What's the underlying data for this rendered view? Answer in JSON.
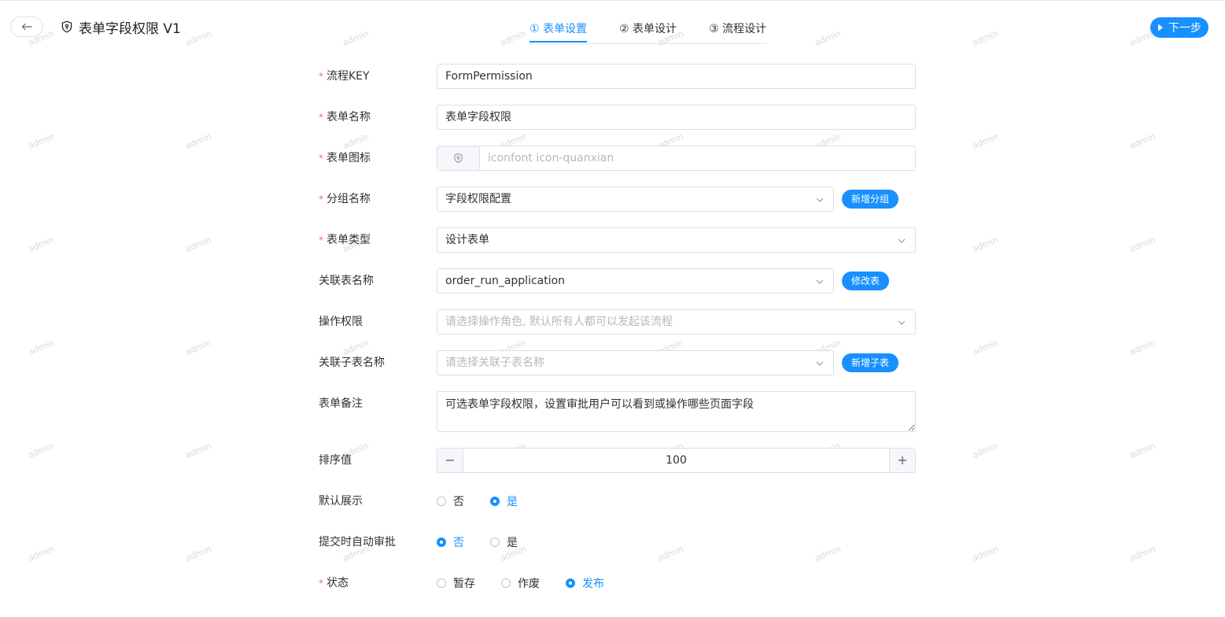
{
  "header": {
    "title": "表单字段权限 V1",
    "next_label": "下一步"
  },
  "steps": [
    {
      "label": "① 表单设置",
      "active": true
    },
    {
      "label": "② 表单设计",
      "active": false
    },
    {
      "label": "③ 流程设计",
      "active": false
    }
  ],
  "watermark": "admin",
  "form": {
    "process_key": {
      "label": "流程KEY",
      "required": true,
      "value": "FormPermission"
    },
    "form_name": {
      "label": "表单名称",
      "required": true,
      "value": "表单字段权限"
    },
    "form_icon": {
      "label": "表单图标",
      "required": true,
      "placeholder": "iconfont icon-quanxian"
    },
    "group_name": {
      "label": "分组名称",
      "required": true,
      "value": "字段权限配置",
      "button": "新增分组"
    },
    "form_type": {
      "label": "表单类型",
      "required": true,
      "value": "设计表单"
    },
    "linked_table": {
      "label": "关联表名称",
      "required": false,
      "value": "order_run_application",
      "button": "修改表"
    },
    "permission": {
      "label": "操作权限",
      "required": false,
      "placeholder": "请选择操作角色, 默认所有人都可以发起该流程"
    },
    "sub_table": {
      "label": "关联子表名称",
      "required": false,
      "placeholder": "请选择关联子表名称",
      "button": "新增子表"
    },
    "remark": {
      "label": "表单备注",
      "required": false,
      "value": "可选表单字段权限，设置审批用户可以看到或操作哪些页面字段"
    },
    "sort": {
      "label": "排序值",
      "required": false,
      "value": "100",
      "minus": "−",
      "plus": "+"
    },
    "default_show": {
      "label": "默认展示",
      "required": false,
      "options": [
        "否",
        "是"
      ],
      "selected": "是"
    },
    "auto_approve": {
      "label": "提交时自动审批",
      "required": false,
      "options": [
        "否",
        "是"
      ],
      "selected": "否"
    },
    "status": {
      "label": "状态",
      "required": true,
      "options": [
        "暂存",
        "作废",
        "发布"
      ],
      "selected": "发布"
    }
  },
  "colors": {
    "primary": "#1890ff",
    "required": "#f56c6c",
    "border": "#dcdfe6"
  },
  "icons": {
    "back": "arrow-left-icon",
    "title": "shield-icon",
    "next": "play-icon",
    "select": "chevron-down-icon"
  }
}
